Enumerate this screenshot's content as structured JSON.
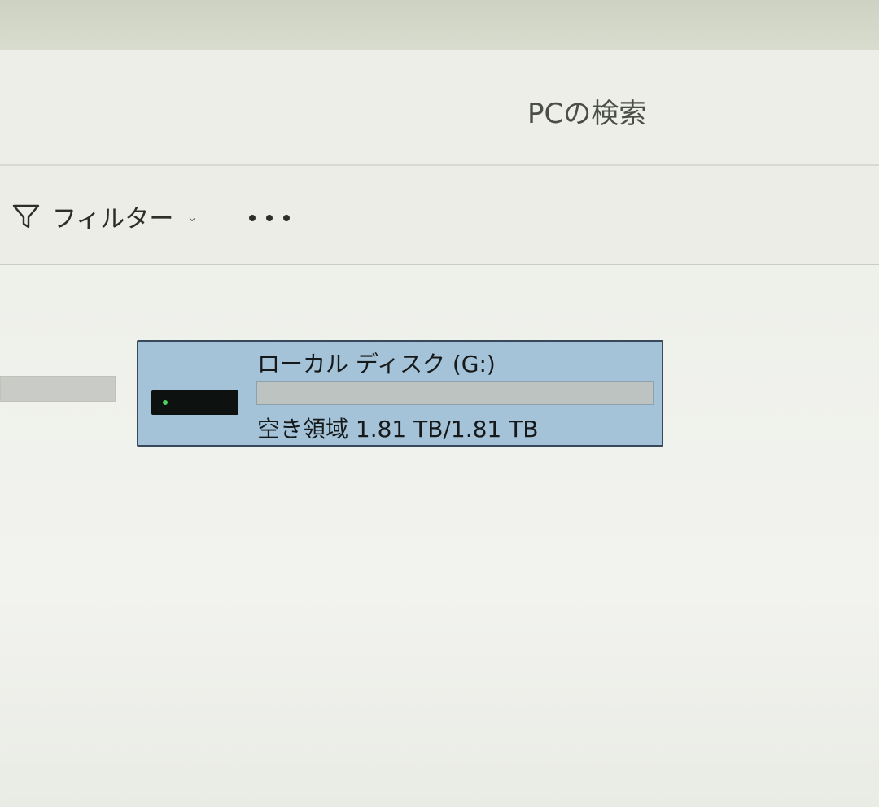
{
  "header": {
    "search_placeholder": "PCの検索"
  },
  "toolbar": {
    "filter_label": "フィルター",
    "filter_icon": "filter-icon",
    "filter_chevron": "⌄",
    "more_icon": "more-icon"
  },
  "drive": {
    "name": "ローカル ディスク (G:)",
    "free_text": "空き領域 1.81 TB/1.81 TB",
    "used_fraction": 0.0,
    "icon": "hard-drive-icon"
  },
  "colors": {
    "tile_selected_bg": "#a4c2d8",
    "tile_border": "#37495a",
    "usage_track": "#bdc3c1",
    "usage_fill": "#2b82d6",
    "led": "#4cd35a"
  }
}
